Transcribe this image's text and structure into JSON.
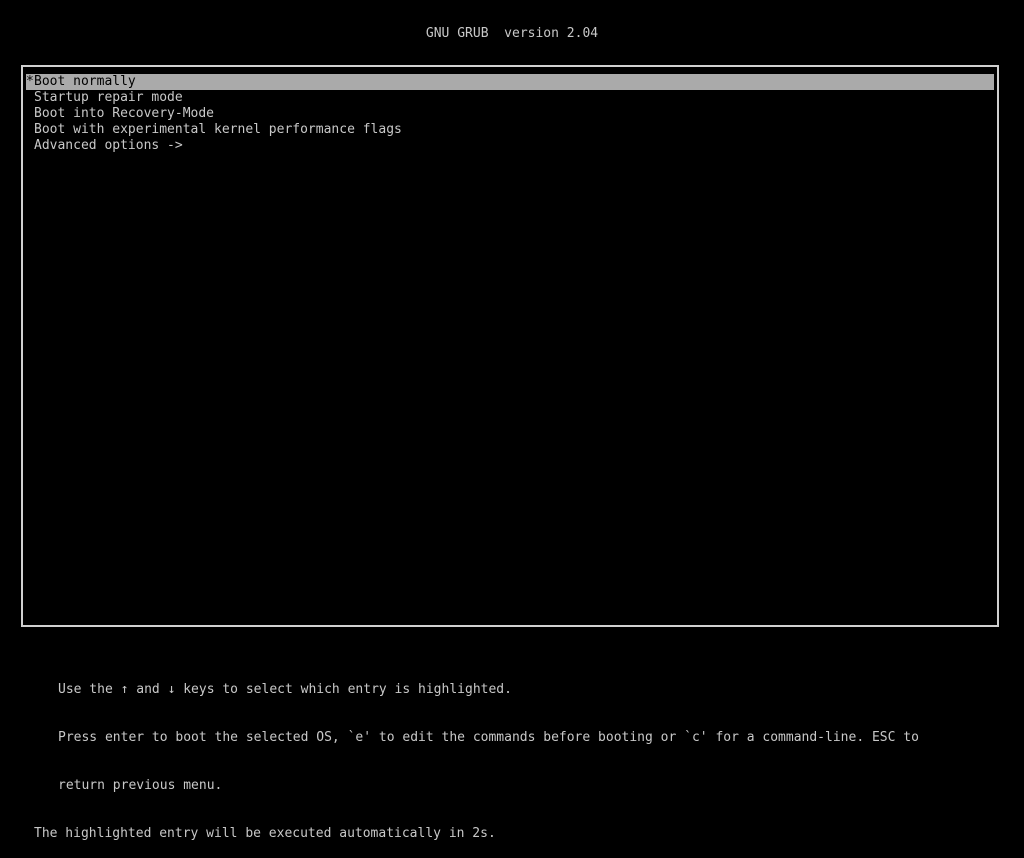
{
  "header": {
    "title": "GNU GRUB  version 2.04"
  },
  "menu": {
    "selected_marker": "*",
    "entries": [
      {
        "label": "Boot normally",
        "selected": true
      },
      {
        "label": "Startup repair mode",
        "selected": false
      },
      {
        "label": "Boot into Recovery-Mode",
        "selected": false
      },
      {
        "label": "Boot with experimental kernel performance flags",
        "selected": false
      },
      {
        "label": "Advanced options ->",
        "selected": false
      }
    ]
  },
  "help": {
    "line1": "Use the ↑ and ↓ keys to select which entry is highlighted.",
    "line2": "Press enter to boot the selected OS, `e' to edit the commands before booting or `c' for a command-line. ESC to",
    "line3": "return previous menu.",
    "countdown": "The highlighted entry will be executed automatically in 2s."
  },
  "colors": {
    "background": "#000000",
    "text": "#c8c8c8",
    "highlight_bg": "#aaaaaa",
    "highlight_text": "#000000",
    "border": "#d0d0d0"
  }
}
